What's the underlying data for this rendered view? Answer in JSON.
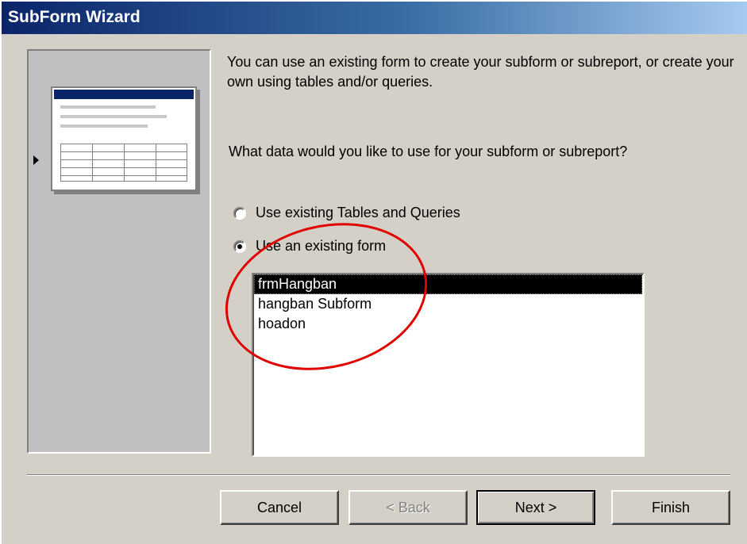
{
  "window": {
    "title": "SubForm Wizard"
  },
  "intro_text": "You can use an existing form to create your subform or subreport, or create your own using tables and/or queries.",
  "question_text": "What data would you like to use for your subform or subreport?",
  "options": [
    {
      "label": "Use existing Tables and Queries",
      "checked": false
    },
    {
      "label": "Use an existing form",
      "checked": true
    }
  ],
  "forms_list": {
    "items": [
      "frmHangban",
      "hangban Subform",
      "hoadon"
    ],
    "selected_index": 0
  },
  "buttons": {
    "cancel": "Cancel",
    "back": "< Back",
    "next": "Next >",
    "finish": "Finish"
  },
  "annotation": {
    "circle_color": "#e00000"
  }
}
